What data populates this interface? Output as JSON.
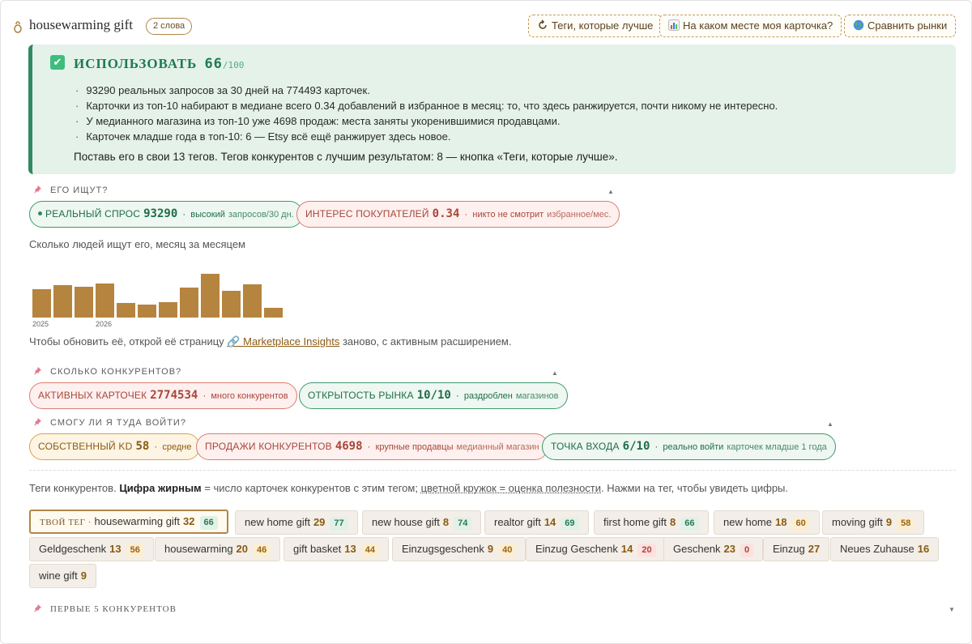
{
  "header": {
    "title": "housewarming gift",
    "word_badge": "2 слова",
    "buttons": [
      {
        "label": "Теги, которые лучше",
        "icon": "refresh-icon"
      },
      {
        "label": "На каком месте моя карточка?",
        "icon": "bar-chart-icon"
      },
      {
        "label": "Сравнить рынки",
        "icon": "globe-icon"
      }
    ]
  },
  "verdict": {
    "title": "ИСПОЛЬЗОВАТЬ",
    "score": "66",
    "score_max": "/100",
    "bullets": [
      "93290 реальных запросов за 30 дней на 774493 карточек.",
      "Карточки из топ-10 набирают в медиане всего 0.34 добавлений в избранное в месяц: то, что здесь ранжируется, почти никому не интересно.",
      "У медианного магазина из топ-10 уже 4698 продаж: места заняты укоренившимися продавцами.",
      "Карточек младше года в топ-10: 6 — Etsy всё ещё ранжирует здесь новое."
    ],
    "footer": "Поставь его в свои 13 тегов. Тегов конкурентов с лучшим результатом: 8 — кнопка «Теги, которые лучше»."
  },
  "demand": {
    "section_title": "ЕГО ИЩУТ?",
    "pills": [
      {
        "label": "РЕАЛЬНЫЙ СПРОС",
        "value": "93290",
        "word": "высокий",
        "unit": "запросов/30 дн."
      },
      {
        "label": "ИНТЕРЕС ПОКУПАТЕЛЕЙ",
        "value": "0.34",
        "word": "никто не смотрит",
        "unit": "избранное/мес."
      }
    ],
    "chart_caption": "Сколько людей ищут его, месяц за месяцем",
    "refresh_prefix": "Чтобы обновить её, открой её страницу",
    "refresh_link": "Marketplace Insights",
    "refresh_suffix": "заново, с активным расширением."
  },
  "chart_data": {
    "type": "bar",
    "title": "",
    "values": [
      35,
      40,
      38,
      42,
      18,
      16,
      19,
      37,
      54,
      33,
      41,
      12
    ],
    "tick_labels": [
      {
        "index": 0,
        "label": "2025"
      },
      {
        "index": 3,
        "label": "2026"
      }
    ],
    "color": "#b5843f"
  },
  "competition": {
    "section_title": "СКОЛЬКО КОНКУРЕНТОВ?",
    "pills": [
      {
        "label": "АКТИВНЫХ КАРТОЧЕК",
        "value": "2774534",
        "word": "много конкурентов",
        "unit": ""
      },
      {
        "label": "ОТКРЫТОСТЬ РЫНКА",
        "value": "10/10",
        "word": "раздроблен",
        "unit": "магазинов"
      }
    ]
  },
  "entry": {
    "section_title": "СМОГУ ЛИ Я ТУДА ВОЙТИ?",
    "pills": [
      {
        "label": "СОБСТВЕННЫЙ KD",
        "value": "58",
        "word": "средне",
        "unit": ""
      },
      {
        "label": "ПРОДАЖИ КОНКУРЕНТОВ",
        "value": "4698",
        "word": "крупные продавцы",
        "unit": "медианный магазин"
      },
      {
        "label": "ТОЧКА ВХОДА",
        "value": "6/10",
        "word": "реально войти",
        "unit": "карточек младше 1 года"
      }
    ]
  },
  "tags_legend": {
    "prefix": "Теги конкурентов.",
    "bold": "Цифра жирным",
    "middle": "= число карточек конкурентов с этим тегом;",
    "underlined": "цветной кружок = оценка полезности",
    "suffix": ". Нажми на тег, чтобы увидеть цифры."
  },
  "tags": {
    "own_label": "ТВОЙ ТЕГ ·",
    "items": [
      {
        "name": "housewarming gift",
        "count": "32",
        "score": "66",
        "level": "green",
        "own": true
      },
      {
        "name": "new home gift",
        "count": "29",
        "score": "77",
        "level": "green"
      },
      {
        "name": "new house gift",
        "count": "8",
        "score": "74",
        "level": "green"
      },
      {
        "name": "realtor gift",
        "count": "14",
        "score": "69",
        "level": "green"
      },
      {
        "name": "first home gift",
        "count": "8",
        "score": "66",
        "level": "green"
      },
      {
        "name": "new home",
        "count": "18",
        "score": "60",
        "level": "amber"
      },
      {
        "name": "moving gift",
        "count": "9",
        "score": "58",
        "level": "amber"
      },
      {
        "name": "Geldgeschenk",
        "count": "13",
        "score": "56",
        "level": "amber"
      },
      {
        "name": "housewarming",
        "count": "20",
        "score": "46",
        "level": "amber"
      },
      {
        "name": "gift basket",
        "count": "13",
        "score": "44",
        "level": "amber"
      },
      {
        "name": "Einzugsgeschenk",
        "count": "9",
        "score": "40",
        "level": "amber"
      },
      {
        "name": "Einzug Geschenk",
        "count": "14",
        "score": "20",
        "level": "red"
      },
      {
        "name": "Geschenk",
        "count": "23",
        "score": "0",
        "level": "red"
      },
      {
        "name": "Einzug",
        "count": "27",
        "score": null,
        "level": ""
      },
      {
        "name": "Neues Zuhause",
        "count": "16",
        "score": null,
        "level": ""
      },
      {
        "name": "wine gift",
        "count": "9",
        "score": null,
        "level": ""
      }
    ]
  },
  "top5": {
    "section_title": "ПЕРВЫЕ 5 КОНКУРЕНТОВ"
  }
}
